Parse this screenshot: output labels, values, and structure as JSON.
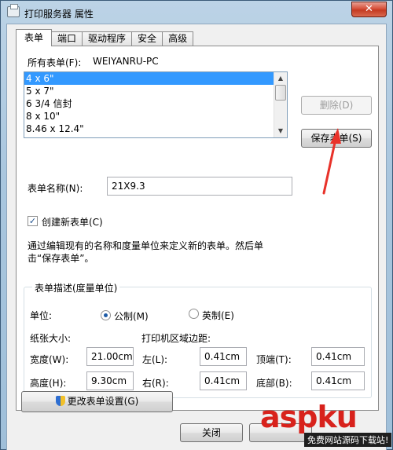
{
  "window": {
    "title": "打印服务器 属性",
    "close_glyph": "✕"
  },
  "tabs": [
    {
      "label": "表单",
      "active": true
    },
    {
      "label": "端口",
      "active": false
    },
    {
      "label": "驱动程序",
      "active": false
    },
    {
      "label": "安全",
      "active": false
    },
    {
      "label": "高级",
      "active": false
    }
  ],
  "forms_on": {
    "label": "所有表单(F):",
    "server": "WEIYANRU-PC"
  },
  "forms_list": [
    {
      "label": "4 x 6\"",
      "selected": true
    },
    {
      "label": "5 x 7\"",
      "selected": false
    },
    {
      "label": "6 3/4 信封",
      "selected": false
    },
    {
      "label": "8 x 10\"",
      "selected": false
    },
    {
      "label": "8.46 x 12.4\"",
      "selected": false
    }
  ],
  "buttons": {
    "delete": "删除(D)",
    "save_form": "保存表单(S)",
    "change_settings": "更改表单设置(G)",
    "close": "关闭"
  },
  "form_name": {
    "label": "表单名称(N):",
    "value": "21X9.3"
  },
  "create_new": {
    "label": "创建新表单(C)",
    "checked": true
  },
  "description": "通过编辑现有的名称和度量单位来定义新的表单。然后单击“保存表单”。",
  "group": {
    "title": "表单描述(度量单位)",
    "unit_label": "单位:",
    "metric": "公制(M)",
    "english": "英制(E)",
    "paper_size_label": "纸张大小:",
    "margins_label": "打印机区域边距:",
    "width_label": "宽度(W):",
    "width_value": "21.00cm",
    "height_label": "高度(H):",
    "height_value": "9.30cm",
    "left_label": "左(L):",
    "left_value": "0.41cm",
    "right_label": "右(R):",
    "right_value": "0.41cm",
    "top_label": "顶端(T):",
    "top_value": "0.41cm",
    "bottom_label": "底部(B):",
    "bottom_value": "0.41cm"
  },
  "watermark": {
    "text": "aspku",
    "subtext": "免费网站源码下载站!"
  },
  "colors": {
    "selection": "#3399ff",
    "arrow": "#e8322a",
    "close_button": "#c43a22"
  }
}
